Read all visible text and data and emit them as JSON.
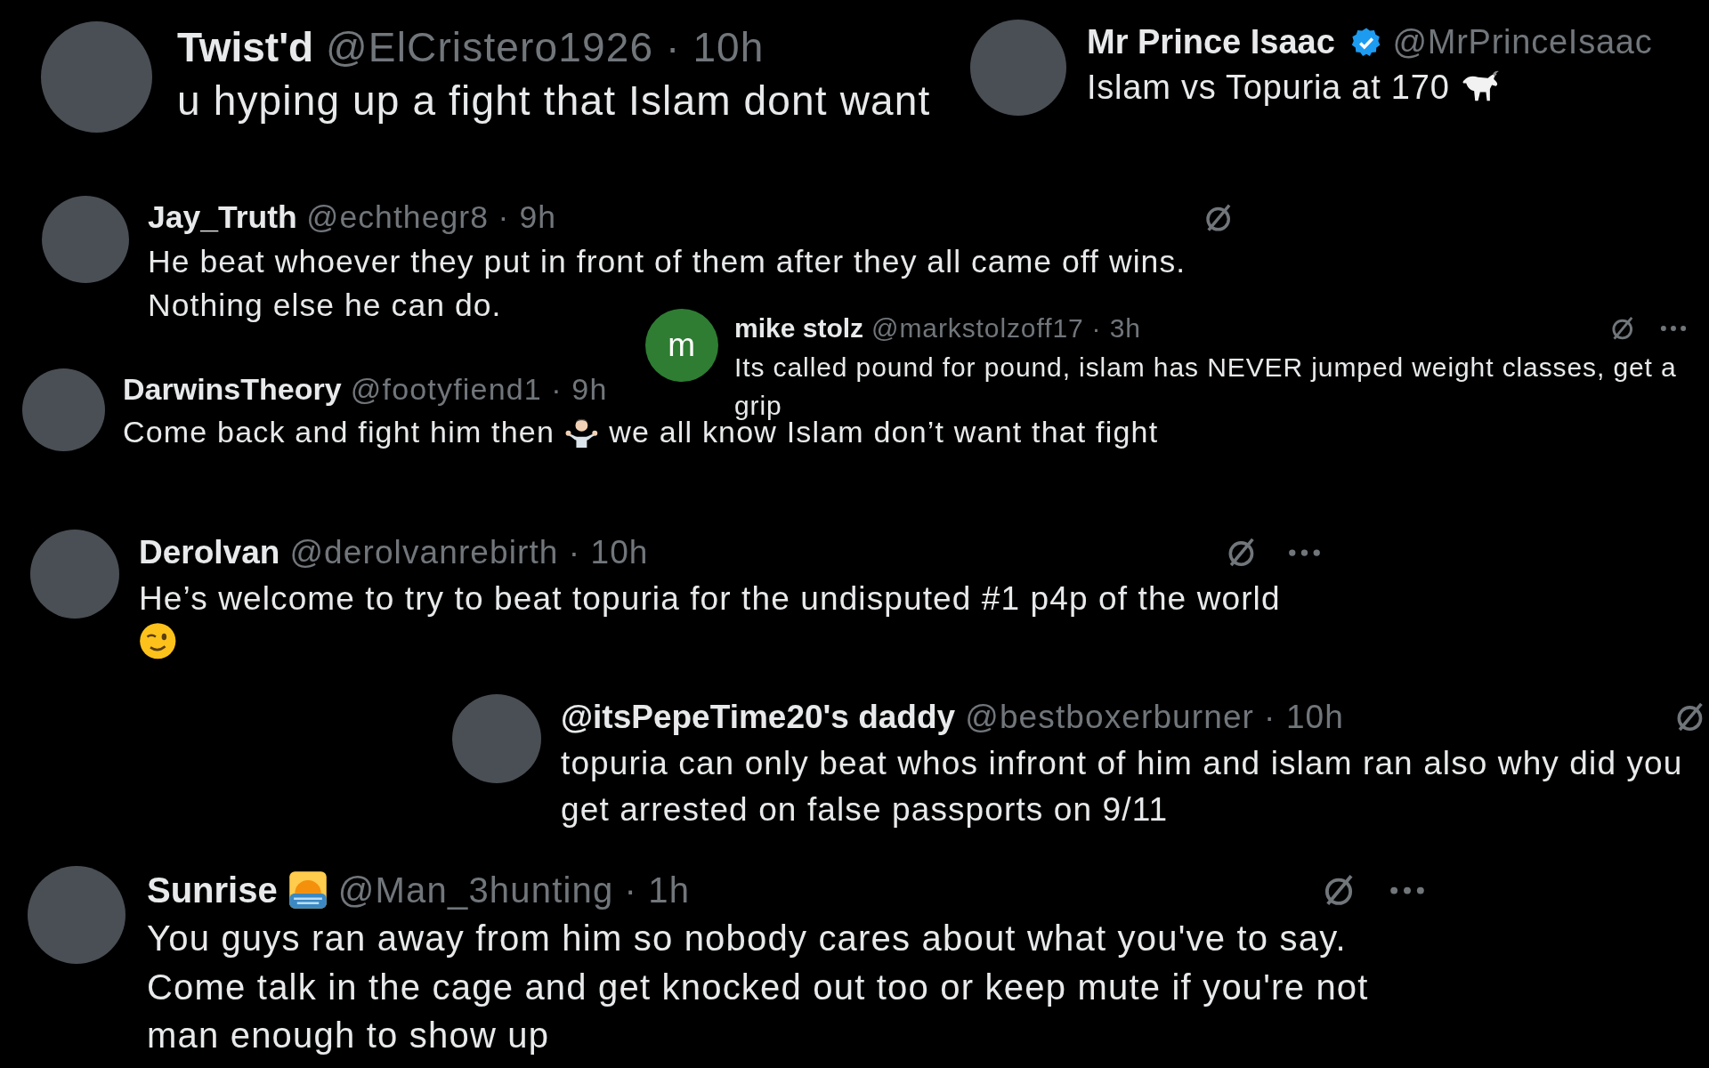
{
  "posts": [
    {
      "name": "Twist'd",
      "verified": false,
      "handle": "@ElCristero1926",
      "time": "· 10h",
      "avatar": {
        "kind": "photo"
      },
      "mute_button": false,
      "more_button": false,
      "lines": [
        [
          {
            "kind": "text",
            "text": "u hyping up a fight that Islam dont want"
          }
        ]
      ]
    },
    {
      "name": "Mr Prince Isaac",
      "verified": true,
      "handle": "@MrPrinceIsaac",
      "avatar": {
        "kind": "photo"
      },
      "mute_button": false,
      "more_button": false,
      "lines": [
        [
          {
            "kind": "text",
            "text": "Islam vs Topuria at 170"
          },
          {
            "kind": "goat"
          }
        ]
      ]
    },
    {
      "name": "Jay_Truth",
      "verified": false,
      "handle": "@echthegr8",
      "time": "· 9h",
      "avatar": {
        "kind": "photo"
      },
      "mute_button": true,
      "more_button": false,
      "lines": [
        [
          {
            "kind": "text",
            "text": "He beat whoever they put in front of them after they all came off wins."
          }
        ],
        [
          {
            "kind": "text",
            "text": "Nothing else he can do."
          }
        ]
      ]
    },
    {
      "name": "mike stolz",
      "verified": false,
      "handle": "@markstolzoff17",
      "time": "· 3h",
      "avatar": {
        "kind": "letter",
        "letter": "m"
      },
      "mute_button": true,
      "more_button": true,
      "lines": [
        [
          {
            "kind": "text",
            "text": "Its called pound for pound, islam has NEVER jumped weight classes, get a"
          }
        ],
        [
          {
            "kind": "text",
            "text": "grip"
          }
        ]
      ]
    },
    {
      "name": "DarwinsTheory",
      "verified": false,
      "handle": "@footyfiend1",
      "time": "· 9h",
      "avatar": {
        "kind": "photo"
      },
      "mute_button": false,
      "more_button": false,
      "lines": [
        [
          {
            "kind": "text",
            "text": "Come back and fight him then"
          },
          {
            "kind": "shrug"
          },
          {
            "kind": "text",
            "text": "we all know Islam don’t want that fight"
          }
        ]
      ]
    },
    {
      "name": "Derolvan",
      "verified": false,
      "handle": "@derolvanrebirth",
      "time": "· 10h",
      "avatar": {
        "kind": "photo"
      },
      "mute_button": true,
      "more_button": true,
      "lines": [
        [
          {
            "kind": "text",
            "text": "He’s welcome to try to beat topuria for the undisputed #1 p4p of the world"
          }
        ],
        [
          {
            "kind": "wink"
          }
        ]
      ]
    },
    {
      "name": "@itsPepeTime20's daddy",
      "verified": false,
      "handle": "@bestboxerburner",
      "time": "· 10h",
      "avatar": {
        "kind": "photo"
      },
      "mute_button": true,
      "more_button": false,
      "lines": [
        [
          {
            "kind": "text",
            "text": "topuria can only beat whos infront of him and islam ran also why did you"
          }
        ],
        [
          {
            "kind": "text",
            "text": "get arrested on false passports on 9/11"
          }
        ]
      ]
    },
    {
      "name": "Sunrise",
      "name_icon": {
        "kind": "sunrise"
      },
      "verified": false,
      "handle": "@Man_3hunting",
      "time": "· 1h",
      "avatar": {
        "kind": "photo"
      },
      "mute_button": true,
      "more_button": true,
      "lines": [
        [
          {
            "kind": "text",
            "text": "You guys ran away from him so nobody cares about what you've to say."
          }
        ],
        [
          {
            "kind": "text",
            "text": "Come talk in the cage and get knocked out too or keep mute if you're not"
          }
        ],
        [
          {
            "kind": "text",
            "text": "man enough to show up"
          }
        ]
      ]
    }
  ]
}
